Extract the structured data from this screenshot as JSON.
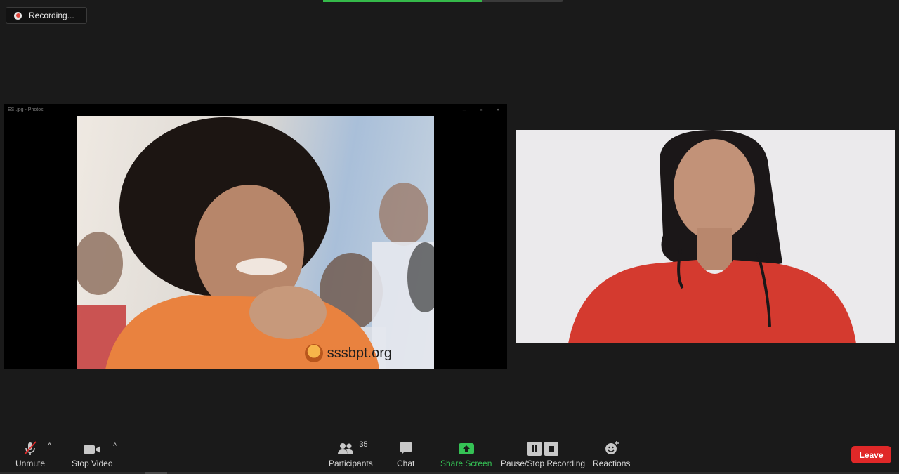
{
  "recording": {
    "label": "Recording...",
    "dot_color": "#e0443a"
  },
  "shared_screen": {
    "window_title": "ESI.jpg - Photos",
    "watermark": "sssbpt.org"
  },
  "toolbar": {
    "unmute_label": "Unmute",
    "stop_video_label": "Stop Video",
    "participants_label": "Participants",
    "participants_count": "35",
    "chat_label": "Chat",
    "share_screen_label": "Share Screen",
    "recording_label": "Pause/Stop Recording",
    "reactions_label": "Reactions",
    "leave_label": "Leave"
  },
  "colors": {
    "background": "#1a1a1a",
    "share_green": "#35c255",
    "leave_red": "#e02828",
    "mute_slash": "#e02828"
  },
  "icons": [
    "mic-muted-icon",
    "video-camera-icon",
    "participants-icon",
    "chat-icon",
    "share-screen-icon",
    "pause-icon",
    "stop-icon",
    "reactions-icon",
    "chevron-up-icon"
  ]
}
